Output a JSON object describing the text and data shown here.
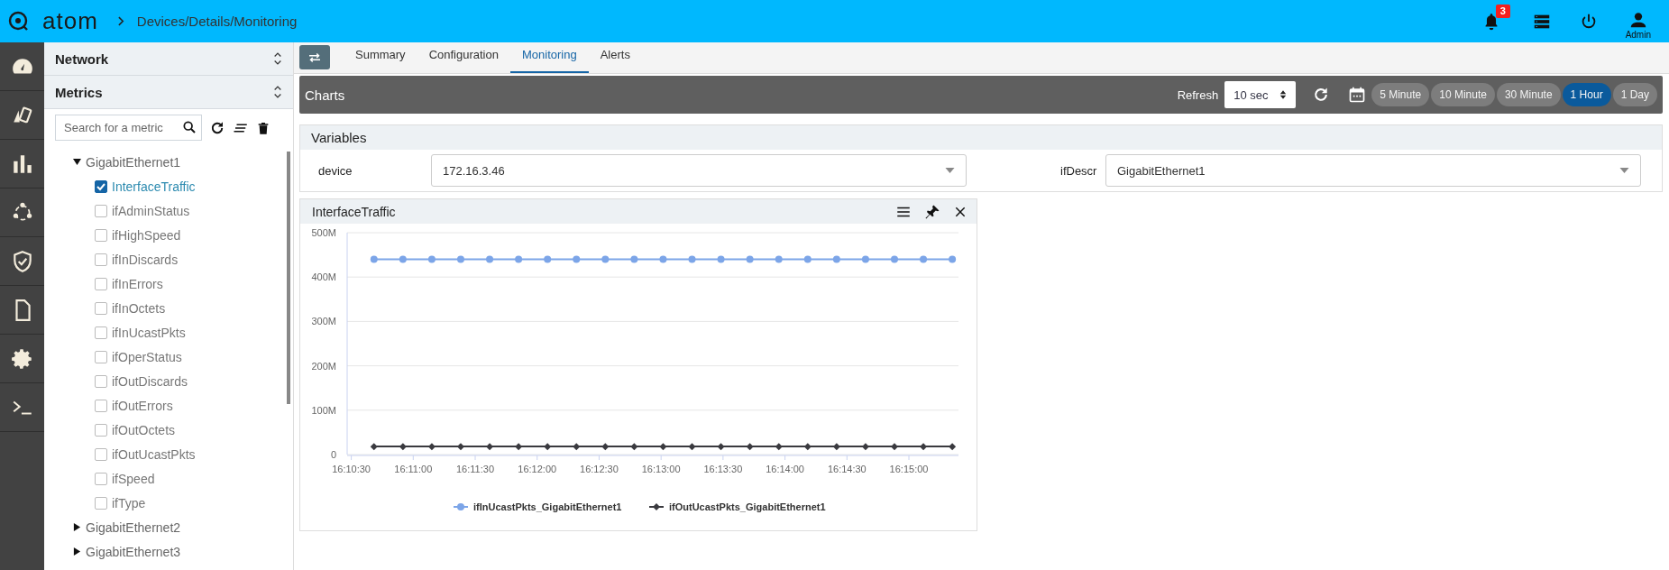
{
  "header": {
    "logo": "atom",
    "breadcrumb": "Devices/Details/Monitoring",
    "notifications": "3",
    "user": "Admin"
  },
  "sidebar": {
    "sections": [
      {
        "title": "Network"
      },
      {
        "title": "Metrics"
      }
    ],
    "search": {
      "placeholder": "Search for a metric"
    },
    "tree": [
      {
        "label": "GigabitEthernet1",
        "expanded": true,
        "children": [
          {
            "label": "InterfaceTraffic",
            "checked": true
          },
          {
            "label": "ifAdminStatus",
            "checked": false
          },
          {
            "label": "ifHighSpeed",
            "checked": false
          },
          {
            "label": "ifInDiscards",
            "checked": false
          },
          {
            "label": "ifInErrors",
            "checked": false
          },
          {
            "label": "ifInOctets",
            "checked": false
          },
          {
            "label": "ifInUcastPkts",
            "checked": false
          },
          {
            "label": "ifOperStatus",
            "checked": false
          },
          {
            "label": "ifOutDiscards",
            "checked": false
          },
          {
            "label": "ifOutErrors",
            "checked": false
          },
          {
            "label": "ifOutOctets",
            "checked": false
          },
          {
            "label": "ifOutUcastPkts",
            "checked": false
          },
          {
            "label": "ifSpeed",
            "checked": false
          },
          {
            "label": "ifType",
            "checked": false
          }
        ]
      },
      {
        "label": "GigabitEthernet2",
        "expanded": false
      },
      {
        "label": "GigabitEthernet3",
        "expanded": false
      }
    ]
  },
  "tabs": [
    {
      "label": "Summary",
      "selected": false
    },
    {
      "label": "Configuration",
      "selected": false
    },
    {
      "label": "Monitoring",
      "selected": true
    },
    {
      "label": "Alerts",
      "selected": false
    }
  ],
  "charts_bar": {
    "title": "Charts",
    "refresh_label": "Refresh",
    "refresh_value": "10 sec",
    "ranges": [
      {
        "label": "5 Minute",
        "selected": false
      },
      {
        "label": "10 Minute",
        "selected": false
      },
      {
        "label": "30 Minute",
        "selected": false
      },
      {
        "label": "1 Hour",
        "selected": true
      },
      {
        "label": "1 Day",
        "selected": false
      }
    ]
  },
  "variables": {
    "title": "Variables",
    "fields": [
      {
        "label": "device",
        "value": "172.16.3.46"
      },
      {
        "label": "ifDescr",
        "value": "GigabitEthernet1"
      }
    ]
  },
  "chart_panel": {
    "title": "InterfaceTraffic",
    "chart_data": {
      "type": "line",
      "grid": true,
      "legend": true,
      "x": [
        58241,
        58255,
        58269,
        58283,
        58297,
        58311,
        58325,
        58339,
        58353,
        58367,
        58381,
        58395,
        58409,
        58423,
        58437,
        58451,
        58465,
        58479,
        58493,
        58507,
        58521
      ],
      "series": [
        {
          "name": "ifInUcastPkts_GigabitEthernet1",
          "color": "#7ca5e8",
          "marker": "circle",
          "values": [
            440000000,
            440000000,
            440000000,
            440000000,
            440000000,
            440000000,
            440000000,
            440000000,
            440000000,
            440000000,
            440000000,
            440000000,
            440000000,
            440000000,
            440000000,
            440000000,
            440000000,
            440000000,
            440000000,
            440000000,
            440000000
          ]
        },
        {
          "name": "ifOutUcastPkts_GigabitEthernet1",
          "color": "#3a3a3f",
          "marker": "diamond",
          "values": [
            18000000,
            18000000,
            18000000,
            18000000,
            18000000,
            18000000,
            18000000,
            18000000,
            18000000,
            18000000,
            18000000,
            18000000,
            18000000,
            18000000,
            18000000,
            18000000,
            18000000,
            18000000,
            18000000,
            18000000,
            18000000
          ]
        }
      ],
      "xlim": [
        58228,
        58524
      ],
      "ylim": [
        0,
        500000000
      ],
      "xticks": [
        {
          "value": 58230,
          "label": "16:10:30"
        },
        {
          "value": 58260,
          "label": "16:11:00"
        },
        {
          "value": 58290,
          "label": "16:11:30"
        },
        {
          "value": 58320,
          "label": "16:12:00"
        },
        {
          "value": 58350,
          "label": "16:12:30"
        },
        {
          "value": 58380,
          "label": "16:13:00"
        },
        {
          "value": 58410,
          "label": "16:13:30"
        },
        {
          "value": 58440,
          "label": "16:14:00"
        },
        {
          "value": 58470,
          "label": "16:14:30"
        },
        {
          "value": 58500,
          "label": "16:15:00"
        }
      ],
      "yticks": [
        {
          "value": 0,
          "label": "0"
        },
        {
          "value": 100000000,
          "label": "100M"
        },
        {
          "value": 200000000,
          "label": "200M"
        },
        {
          "value": 300000000,
          "label": "300M"
        },
        {
          "value": 400000000,
          "label": "400M"
        },
        {
          "value": 500000000,
          "label": "500M"
        }
      ]
    }
  }
}
